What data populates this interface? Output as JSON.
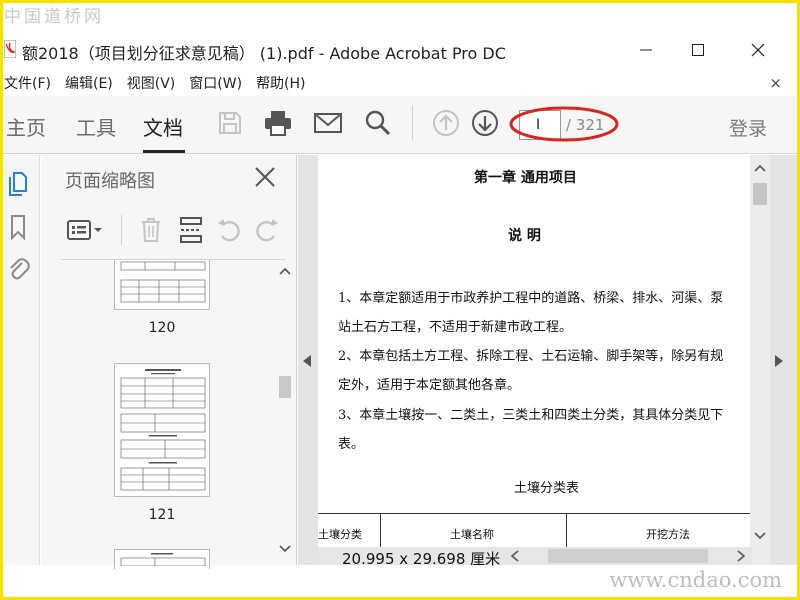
{
  "watermark": {
    "top": "中国道桥网",
    "bottom": "www.cndao.com"
  },
  "window": {
    "title": "额2018（项目划分征求意见稿）  (1).pdf - Adobe Acrobat Pro DC"
  },
  "menu": {
    "items": [
      "文件(F)",
      "编辑(E)",
      "视图(V)",
      "窗口(W)",
      "帮助(H)"
    ],
    "close_glyph": "×"
  },
  "toolbar": {
    "tabs": [
      "主页",
      "工具",
      "文档"
    ],
    "active_tab": "文档",
    "page_current": "I",
    "page_total": "/ 321",
    "login": "登录"
  },
  "thumbnail_panel": {
    "title": "页面缩略图",
    "thumbnails": [
      {
        "label": "120"
      },
      {
        "label": "121"
      }
    ]
  },
  "document": {
    "chapter_title": "第一章    通用项目",
    "section_title": "说    明",
    "paragraphs": [
      "1、本章定额适用于市政养护工程中的道路、桥梁、排水、河渠、泵",
      "站土石方工程，不适用于新建市政工程。",
      "2、本章包括土方工程、拆除工程、土石运输、脚手架等，除另有规",
      "定外，适用于本定额其他各章。",
      "3、本章土壤按一、二类土，三类土和四类土分类，其具体分类见下",
      "表。"
    ],
    "table_title": "土壤分类表",
    "table_headers": [
      "土壤分类",
      "土壤名称",
      "开挖方法"
    ]
  },
  "statusbar": {
    "page_size": "20.995 x 29.698 厘米"
  },
  "colors": {
    "frame": "#f2e300",
    "annotation": "#d9251d",
    "toolbar_bg": "#f6f6f6",
    "icon_gray": "#555555",
    "icon_disabled": "#c4c4c4",
    "blue_icon": "#2680eb"
  }
}
